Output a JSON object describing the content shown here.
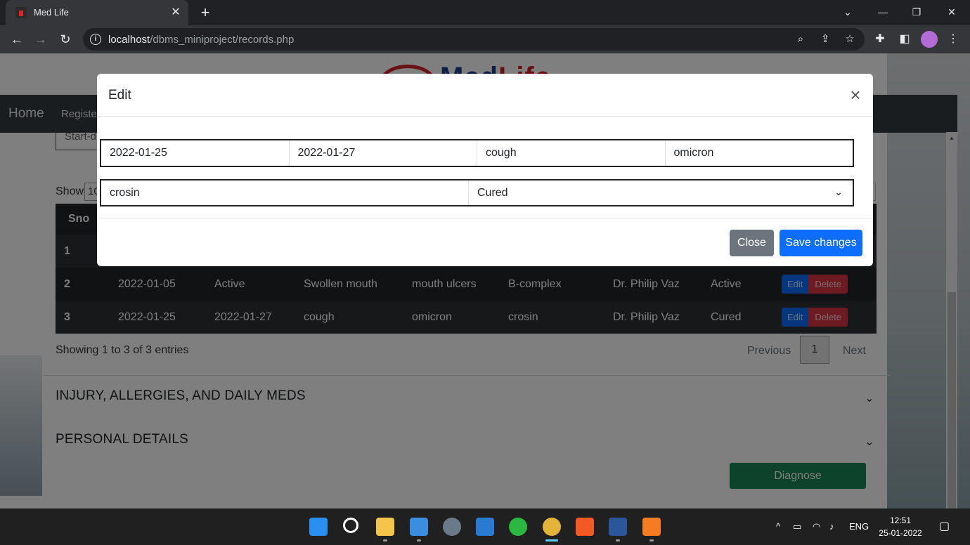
{
  "browser": {
    "tab_title": "Med Life",
    "url_host": "localhost",
    "url_path": "/dbms_miniproject/records.php"
  },
  "page": {
    "logo_text_blue": "Med",
    "logo_text_red": "Life",
    "nav": {
      "home": "Home",
      "register": "Registe"
    },
    "start_date_placeholder": "Start-d",
    "show_label": "Show",
    "show_value": "10",
    "table": {
      "headers": [
        "Sno"
      ],
      "rows": [
        [
          "1",
          "",
          "",
          "",
          "",
          "",
          "",
          ""
        ],
        [
          "2",
          "2022-01-05",
          "Active",
          "Swollen mouth",
          "mouth ulcers",
          "B-complex",
          "Dr. Philip Vaz",
          "Active"
        ],
        [
          "3",
          "2022-01-25",
          "2022-01-27",
          "cough",
          "omicron",
          "crosin",
          "Dr. Philip Vaz",
          "Cured"
        ]
      ],
      "edit_label": "Edit",
      "delete_label": "Delete"
    },
    "showing_text": "Showing 1 to 3 of 3 entries",
    "pagination": {
      "previous": "Previous",
      "current": "1",
      "next": "Next"
    },
    "accordion": [
      {
        "title": "INJURY, ALLERGIES, AND DAILY MEDS"
      },
      {
        "title": "PERSONAL DETAILS"
      }
    ],
    "diagnose_label": "Diagnose"
  },
  "modal": {
    "title": "Edit",
    "start_date": "2022-01-25",
    "end_date": "2022-01-27",
    "symptoms": "cough",
    "disease": "omicron",
    "medicine": "crosin",
    "status_selected": "Cured",
    "close_label": "Close",
    "save_label": "Save changes"
  },
  "taskbar": {
    "lang": "ENG",
    "time": "12:51",
    "date": "25-01-2022"
  },
  "colors": {
    "primary": "#0d6efd",
    "danger": "#dc3545",
    "success": "#198754",
    "secondary": "#6c757d",
    "table_dark": "#212529"
  }
}
